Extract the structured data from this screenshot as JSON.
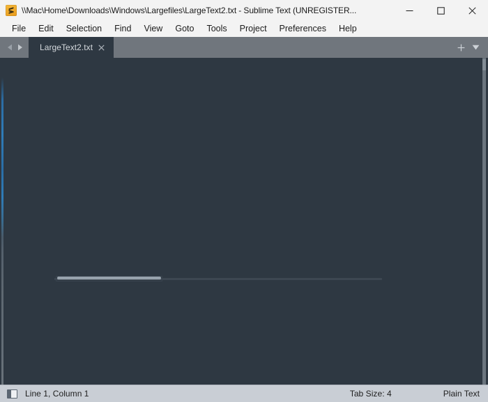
{
  "window": {
    "title": "\\\\Mac\\Home\\Downloads\\Windows\\Largefiles\\LargeText2.txt - Sublime Text (UNREGISTER...",
    "app_icon": "sublime-text-icon",
    "controls": {
      "minimize_label": "Minimize",
      "maximize_label": "Maximize",
      "close_label": "Close"
    },
    "accent_color": "#2f7cb8"
  },
  "menu": {
    "items": [
      {
        "label": "File"
      },
      {
        "label": "Edit"
      },
      {
        "label": "Selection"
      },
      {
        "label": "Find"
      },
      {
        "label": "View"
      },
      {
        "label": "Goto"
      },
      {
        "label": "Tools"
      },
      {
        "label": "Project"
      },
      {
        "label": "Preferences"
      },
      {
        "label": "Help"
      }
    ]
  },
  "tab_bar": {
    "background_color": "#70767d",
    "nav": {
      "previous_label": "Previous tab",
      "next_label": "Next tab"
    },
    "tabs": [
      {
        "label": "LargeText2.txt",
        "active": true,
        "close_label": "×"
      }
    ],
    "actions": {
      "new_tab_label": "+",
      "tab_list_label": "▼"
    }
  },
  "editor": {
    "background_color": "#2e3842",
    "content": "",
    "progress": {
      "visible": true,
      "percent": 33,
      "fill_color": "#98a3ad",
      "track_color": "#3d4752"
    }
  },
  "status_bar": {
    "background_color": "#c9ced5",
    "sidebar_toggle_label": "Toggle sidebar",
    "caret_position": "Line 1, Column 1",
    "tab_size": "Tab Size: 4",
    "syntax": "Plain Text"
  }
}
